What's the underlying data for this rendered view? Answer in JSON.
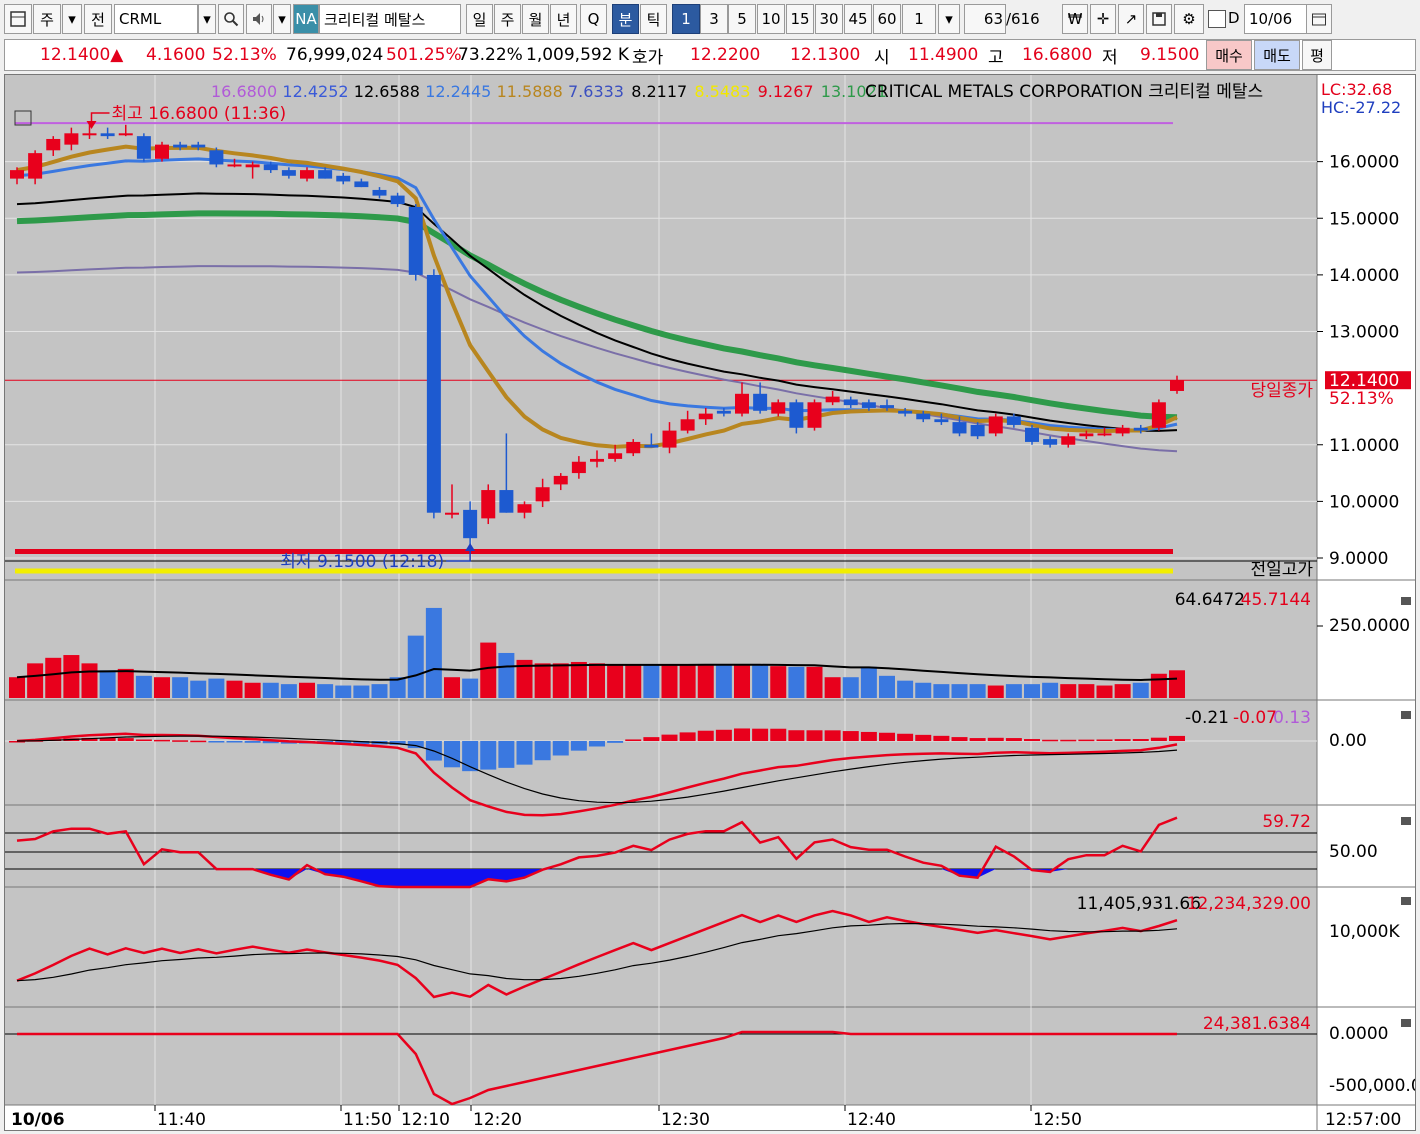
{
  "toolbar": {
    "market": "주",
    "all": "전",
    "symbol": "CRML",
    "na": "NA",
    "name": "크리티컬 메탈스",
    "periods": [
      "일",
      "주",
      "월",
      "년",
      "Q",
      "분",
      "틱"
    ],
    "selected_period": "분",
    "intervals": [
      "1",
      "3",
      "5",
      "10",
      "15",
      "30",
      "45",
      "60"
    ],
    "selected_interval": "1",
    "multiplier": "1",
    "count": "63",
    "count_total": "/616",
    "date_field": "10/06",
    "d_label": "D"
  },
  "quote": {
    "price": "12.1400▲",
    "change": "4.1600",
    "change_pct": "52.13%",
    "volume": "76,999,024",
    "vol_pct": "501.25%",
    "ratio": "73.22%",
    "amount": "1,009,592 K",
    "hoga_label": "호가",
    "ask": "12.2200",
    "bid": "12.1300",
    "open_label": "시",
    "open": "11.4900",
    "high_label": "고",
    "high": "16.6800",
    "low_label": "저",
    "low": "9.1500",
    "buy": "매수",
    "sell": "매도",
    "eval": "평"
  },
  "legend": {
    "values": [
      "16.6800",
      "12.4252",
      "12.6588",
      "12.2445",
      "11.5888",
      "7.6333",
      "8.2117",
      "8.5483",
      "9.1267",
      "13.1021"
    ],
    "colors": [
      "#b15ad8",
      "#3a5ad8",
      "#000000",
      "#3a78e0",
      "#b8861f",
      "#3a4fc0",
      "#000000",
      "#f2e800",
      "#e3001b",
      "#2e9a4a"
    ],
    "title": "CRITICAL METALS CORPORATION  크리티컬 메탈스",
    "lc": "LC:32.68",
    "hc": "HC:-27.22"
  },
  "annotations": {
    "high_label": "최고 16.6800 (11:36)",
    "low_label": "최저 9.1500 (12:18)",
    "current_price": "12.1400",
    "current_pct": "52.13%",
    "prev_close_label": "당일종가",
    "prev_high_label": "전일고가"
  },
  "price_axis": [
    "16.0000",
    "15.0000",
    "14.0000",
    "13.0000",
    "12.1400",
    "11.0000",
    "10.0000",
    "9.0000"
  ],
  "volume_panel": {
    "values_text": "64.6472",
    "values_text2": "45.7144",
    "axis": "250.0000"
  },
  "macd_panel": {
    "v1": "-0.21",
    "v2": "-0.07",
    "v3": "0.13",
    "axis": "0.00"
  },
  "rsi_panel": {
    "v1": "59.72",
    "axis": "50.00"
  },
  "obv_panel": {
    "v1": "11,405,931.66",
    "v2": "12,234,329.00",
    "axis": "10,000K"
  },
  "vo_panel": {
    "v1": "24,381.6384",
    "axis1": "0.0000",
    "axis2": "-500,000.0"
  },
  "time_axis": [
    "10/06",
    "11:40",
    "11:50",
    "12:10",
    "12:20",
    "12:30",
    "12:40",
    "12:50",
    "12:57:00"
  ],
  "chart_data": {
    "type": "candlestick",
    "title": "CRITICAL METALS CORPORATION",
    "ylim": [
      8.7,
      17.0
    ],
    "candles": [
      {
        "o": 15.7,
        "h": 15.9,
        "l": 15.6,
        "c": 15.85
      },
      {
        "o": 15.7,
        "h": 16.2,
        "l": 15.6,
        "c": 16.15
      },
      {
        "o": 16.2,
        "h": 16.45,
        "l": 16.1,
        "c": 16.4
      },
      {
        "o": 16.3,
        "h": 16.6,
        "l": 16.2,
        "c": 16.5
      },
      {
        "o": 16.5,
        "h": 16.68,
        "l": 16.4,
        "c": 16.5
      },
      {
        "o": 16.5,
        "h": 16.6,
        "l": 16.4,
        "c": 16.45
      },
      {
        "o": 16.5,
        "h": 16.65,
        "l": 16.45,
        "c": 16.5
      },
      {
        "o": 16.45,
        "h": 16.5,
        "l": 16.0,
        "c": 16.05
      },
      {
        "o": 16.05,
        "h": 16.35,
        "l": 16.0,
        "c": 16.3
      },
      {
        "o": 16.3,
        "h": 16.35,
        "l": 16.2,
        "c": 16.25
      },
      {
        "o": 16.3,
        "h": 16.35,
        "l": 16.2,
        "c": 16.25
      },
      {
        "o": 16.2,
        "h": 16.25,
        "l": 15.9,
        "c": 15.95
      },
      {
        "o": 15.95,
        "h": 16.05,
        "l": 15.9,
        "c": 15.95
      },
      {
        "o": 15.9,
        "h": 16.0,
        "l": 15.7,
        "c": 15.95
      },
      {
        "o": 15.95,
        "h": 16.0,
        "l": 15.8,
        "c": 15.85
      },
      {
        "o": 15.85,
        "h": 15.9,
        "l": 15.7,
        "c": 15.75
      },
      {
        "o": 15.7,
        "h": 15.9,
        "l": 15.65,
        "c": 15.85
      },
      {
        "o": 15.85,
        "h": 15.9,
        "l": 15.7,
        "c": 15.7
      },
      {
        "o": 15.75,
        "h": 15.8,
        "l": 15.6,
        "c": 15.65
      },
      {
        "o": 15.65,
        "h": 15.7,
        "l": 15.55,
        "c": 15.55
      },
      {
        "o": 15.5,
        "h": 15.55,
        "l": 15.35,
        "c": 15.4
      },
      {
        "o": 15.4,
        "h": 15.45,
        "l": 15.2,
        "c": 15.25
      },
      {
        "o": 15.2,
        "h": 15.25,
        "l": 13.9,
        "c": 14.0
      },
      {
        "o": 14.0,
        "h": 14.1,
        "l": 9.7,
        "c": 9.8
      },
      {
        "o": 9.8,
        "h": 10.3,
        "l": 9.7,
        "c": 9.8
      },
      {
        "o": 9.85,
        "h": 10.0,
        "l": 9.15,
        "c": 9.35
      },
      {
        "o": 9.7,
        "h": 10.3,
        "l": 9.6,
        "c": 10.2
      },
      {
        "o": 10.2,
        "h": 11.2,
        "l": 9.8,
        "c": 9.8
      },
      {
        "o": 9.8,
        "h": 10.0,
        "l": 9.7,
        "c": 9.95
      },
      {
        "o": 10.0,
        "h": 10.4,
        "l": 9.9,
        "c": 10.25
      },
      {
        "o": 10.3,
        "h": 10.5,
        "l": 10.2,
        "c": 10.45
      },
      {
        "o": 10.5,
        "h": 10.8,
        "l": 10.4,
        "c": 10.7
      },
      {
        "o": 10.7,
        "h": 10.9,
        "l": 10.6,
        "c": 10.75
      },
      {
        "o": 10.75,
        "h": 11.0,
        "l": 10.7,
        "c": 10.85
      },
      {
        "o": 10.85,
        "h": 11.1,
        "l": 10.8,
        "c": 11.05
      },
      {
        "o": 11.0,
        "h": 11.2,
        "l": 10.95,
        "c": 10.95
      },
      {
        "o": 10.95,
        "h": 11.4,
        "l": 10.85,
        "c": 11.25
      },
      {
        "o": 11.25,
        "h": 11.6,
        "l": 11.2,
        "c": 11.45
      },
      {
        "o": 11.45,
        "h": 11.65,
        "l": 11.35,
        "c": 11.55
      },
      {
        "o": 11.6,
        "h": 11.65,
        "l": 11.5,
        "c": 11.55
      },
      {
        "o": 11.55,
        "h": 12.1,
        "l": 11.5,
        "c": 11.9
      },
      {
        "o": 11.9,
        "h": 12.1,
        "l": 11.55,
        "c": 11.6
      },
      {
        "o": 11.55,
        "h": 11.8,
        "l": 11.5,
        "c": 11.75
      },
      {
        "o": 11.75,
        "h": 11.8,
        "l": 11.2,
        "c": 11.3
      },
      {
        "o": 11.3,
        "h": 11.8,
        "l": 11.25,
        "c": 11.75
      },
      {
        "o": 11.75,
        "h": 11.95,
        "l": 11.7,
        "c": 11.85
      },
      {
        "o": 11.8,
        "h": 11.85,
        "l": 11.65,
        "c": 11.7
      },
      {
        "o": 11.75,
        "h": 11.8,
        "l": 11.6,
        "c": 11.65
      },
      {
        "o": 11.7,
        "h": 11.8,
        "l": 11.6,
        "c": 11.65
      },
      {
        "o": 11.6,
        "h": 11.65,
        "l": 11.5,
        "c": 11.55
      },
      {
        "o": 11.55,
        "h": 11.6,
        "l": 11.4,
        "c": 11.45
      },
      {
        "o": 11.45,
        "h": 11.55,
        "l": 11.35,
        "c": 11.4
      },
      {
        "o": 11.4,
        "h": 11.5,
        "l": 11.15,
        "c": 11.2
      },
      {
        "o": 11.35,
        "h": 11.4,
        "l": 11.1,
        "c": 11.15
      },
      {
        "o": 11.2,
        "h": 11.55,
        "l": 11.15,
        "c": 11.5
      },
      {
        "o": 11.5,
        "h": 11.55,
        "l": 11.3,
        "c": 11.35
      },
      {
        "o": 11.3,
        "h": 11.35,
        "l": 11.0,
        "c": 11.05
      },
      {
        "o": 11.1,
        "h": 11.15,
        "l": 10.95,
        "c": 11.0
      },
      {
        "o": 11.0,
        "h": 11.2,
        "l": 10.95,
        "c": 11.15
      },
      {
        "o": 11.15,
        "h": 11.25,
        "l": 11.1,
        "c": 11.2
      },
      {
        "o": 11.2,
        "h": 11.3,
        "l": 11.15,
        "c": 11.2
      },
      {
        "o": 11.2,
        "h": 11.35,
        "l": 11.15,
        "c": 11.3
      },
      {
        "o": 11.3,
        "h": 11.35,
        "l": 11.2,
        "c": 11.25
      },
      {
        "o": 11.3,
        "h": 11.8,
        "l": 11.25,
        "c": 11.75
      },
      {
        "o": 11.95,
        "h": 12.22,
        "l": 11.9,
        "c": 12.14
      }
    ],
    "volumes": [
      30,
      50,
      58,
      62,
      50,
      40,
      42,
      32,
      30,
      30,
      25,
      28,
      25,
      22,
      22,
      20,
      22,
      20,
      18,
      18,
      20,
      30,
      90,
      130,
      30,
      28,
      80,
      65,
      55,
      50,
      50,
      52,
      50,
      48,
      48,
      48,
      48,
      48,
      48,
      48,
      48,
      48,
      46,
      45,
      45,
      30,
      30,
      45,
      32,
      25,
      22,
      20,
      20,
      20,
      18,
      20,
      20,
      22,
      20,
      20,
      18,
      20,
      22,
      35,
      40
    ],
    "hlines": {
      "high": 16.68,
      "close_prev": 12.14,
      "low": 9.15
    }
  }
}
